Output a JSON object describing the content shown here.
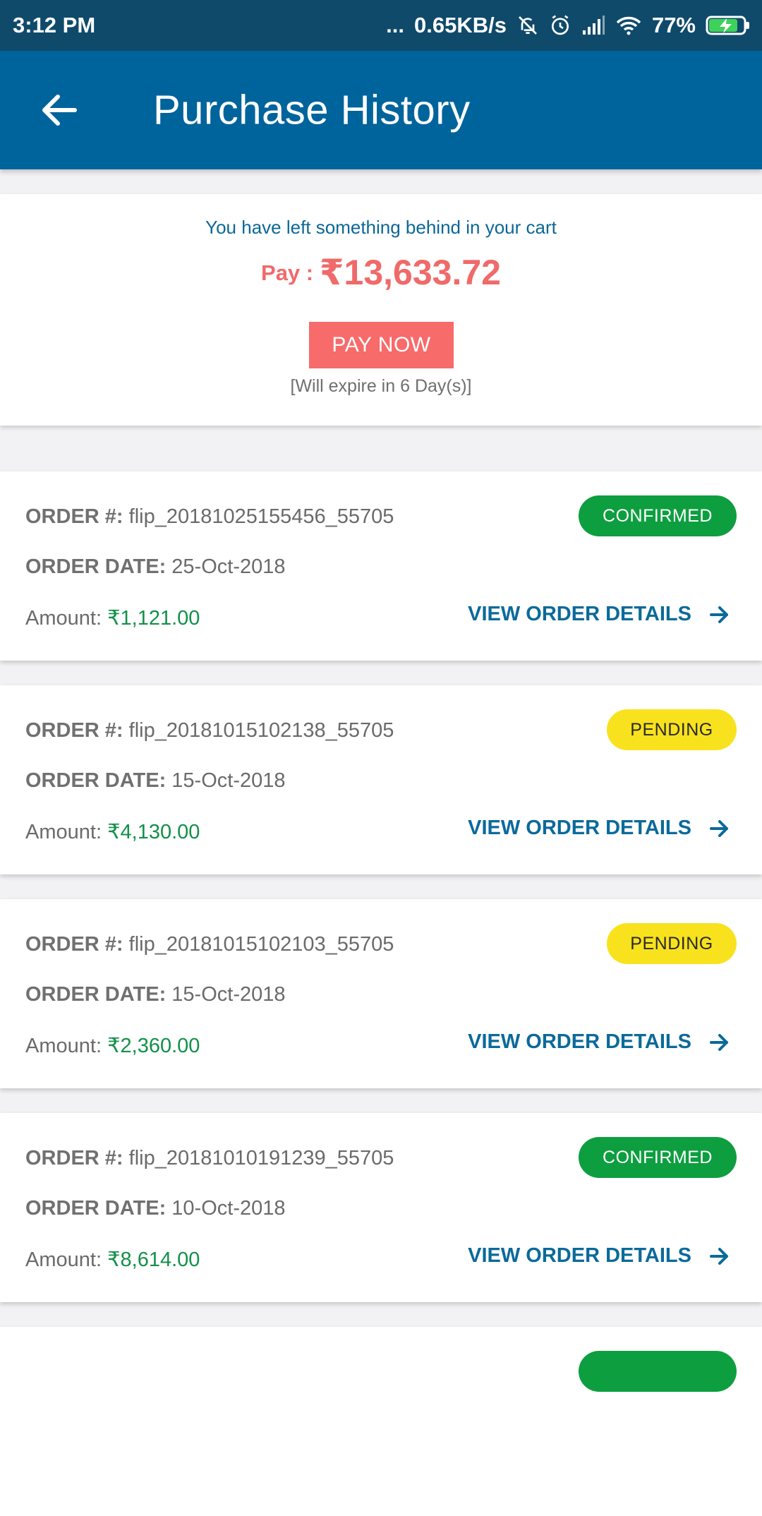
{
  "status_bar": {
    "time": "3:12 PM",
    "dots": "...",
    "net_speed": "0.65KB/s",
    "battery_pct": "77%",
    "icons": [
      "mute-bell-icon",
      "alarm-icon",
      "signal-icon",
      "wifi-icon",
      "battery-charging-icon"
    ]
  },
  "app_bar": {
    "title": "Purchase History",
    "back_icon": "arrow-left-icon",
    "color": "#00649c"
  },
  "cart": {
    "message": "You have left something behind in your cart",
    "pay_label": "Pay : ",
    "amount": "₹13,633.72",
    "button_label": "PAY NOW",
    "expiry": "[Will expire in 6 Day(s)]",
    "accent_color": "#f76b6b"
  },
  "labels": {
    "order_no": "ORDER #:",
    "order_date": "ORDER DATE:",
    "amount": "Amount:",
    "view_details": "VIEW ORDER DETAILS"
  },
  "orders": [
    {
      "order_no": "flip_20181025155456_55705",
      "order_date": "25-Oct-2018",
      "amount": "₹1,121.00",
      "status": "CONFIRMED"
    },
    {
      "order_no": "flip_20181015102138_55705",
      "order_date": "15-Oct-2018",
      "amount": "₹4,130.00",
      "status": "PENDING"
    },
    {
      "order_no": "flip_20181015102103_55705",
      "order_date": "15-Oct-2018",
      "amount": "₹2,360.00",
      "status": "PENDING"
    },
    {
      "order_no": "flip_20181010191239_55705",
      "order_date": "10-Oct-2018",
      "amount": "₹8,614.00",
      "status": "CONFIRMED"
    }
  ],
  "status_colors": {
    "CONFIRMED": "#0d9e3f",
    "PENDING": "#f8e21e"
  }
}
